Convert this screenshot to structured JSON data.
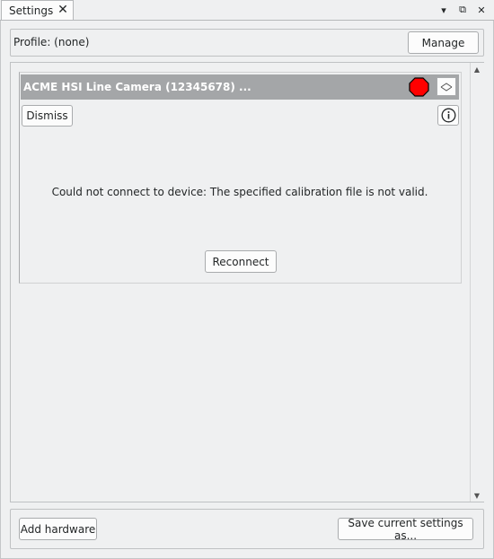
{
  "tab": {
    "title": "Settings",
    "close_glyph": "✕"
  },
  "window_buttons": {
    "menu_glyph": "▾",
    "float_glyph": "⧉",
    "close_glyph": "✕"
  },
  "profile": {
    "label": "Profile:  (none)",
    "manage_label": "Manage"
  },
  "device": {
    "title": "ACME HSI Line Camera (12345678) ...",
    "status_icon": "stop-error-icon",
    "status_color": "#ff0000",
    "dismiss_label": "Dismiss",
    "info_icon": "info-icon",
    "error_message": "Could not connect to device: The specified calibration file is not valid.",
    "reconnect_label": "Reconnect"
  },
  "scrollbar": {
    "up_glyph": "▲",
    "down_glyph": "▼"
  },
  "footer": {
    "add_label": "Add hardware",
    "save_label": "Save current settings as..."
  }
}
